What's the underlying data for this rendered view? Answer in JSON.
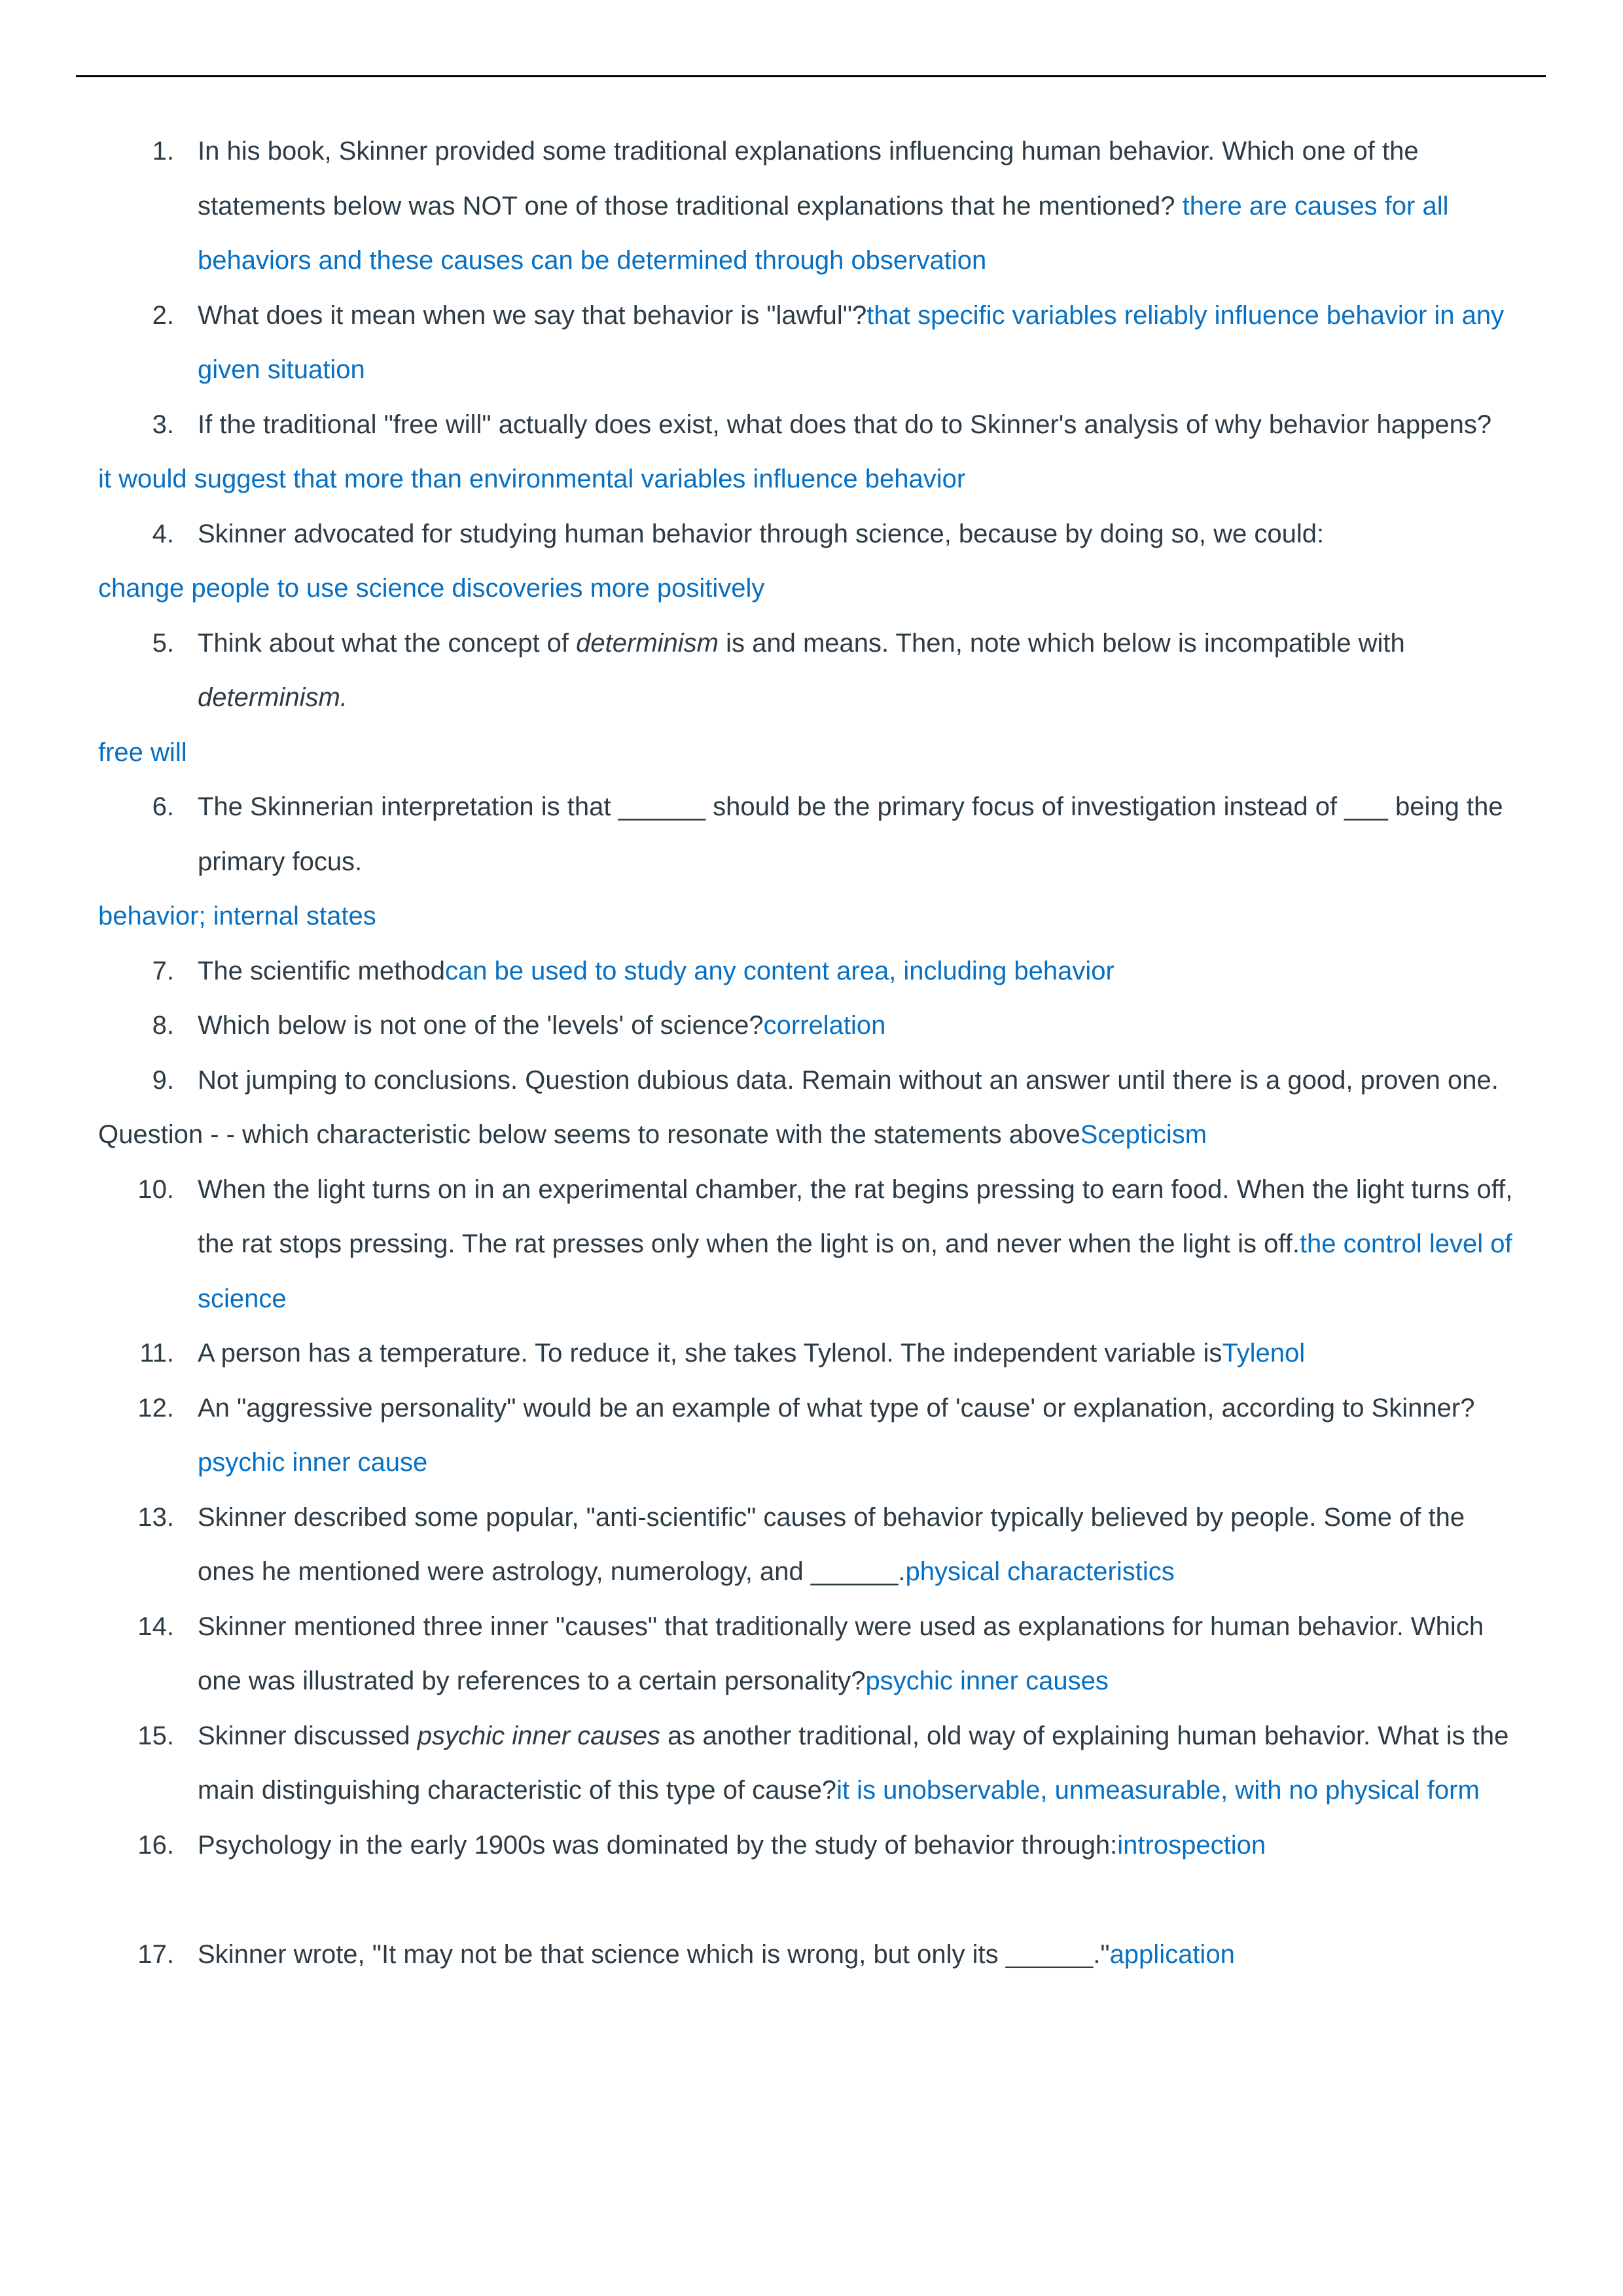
{
  "colors": {
    "question_text": "#2d3b45",
    "answer_text": "#0770c2",
    "rule": "#000000"
  },
  "questions": [
    {
      "n": "1.",
      "parts": [
        {
          "t": "In his book, Skinner provided some traditional explanations influencing human behavior. Which one of the statements below was NOT one of those traditional explanations that he mentioned? "
        },
        {
          "a": "there are causes for all behaviors and these causes can be determined through observation"
        }
      ]
    },
    {
      "n": "2.",
      "parts": [
        {
          "t": "What does it mean when we say that behavior is \"lawful\"?"
        },
        {
          "a": "that specific variables reliably influence behavior in any given situation"
        }
      ]
    },
    {
      "n": "3.",
      "parts": [
        {
          "t": "If the traditional \"free will\" actually does exist, what does that do to Skinner's analysis of why behavior happens?"
        }
      ],
      "after": "it would suggest that more than environmental variables influence behavior"
    },
    {
      "n": "4.",
      "parts": [
        {
          "t": "Skinner advocated for studying human behavior through science, because by doing so, we could:"
        }
      ],
      "after": "change people to use science discoveries more positively"
    },
    {
      "n": "5.",
      "parts": [
        {
          "t": "Think about what the concept of "
        },
        {
          "i": "determinism"
        },
        {
          "t": " is and means. Then, note which below is incompatible with "
        },
        {
          "i": "determinism."
        }
      ],
      "after": "free will"
    },
    {
      "n": "6.",
      "parts": [
        {
          "t": "The Skinnerian interpretation is that ______ should be the primary focus of investigation instead of ___ being the primary focus."
        }
      ],
      "after": "behavior; internal states"
    },
    {
      "n": "7.",
      "parts": [
        {
          "t": "The scientific method"
        },
        {
          "a": "can be used to study any content area, including behavior"
        }
      ]
    },
    {
      "n": "8.",
      "parts": [
        {
          "t": "Which below is not one of the 'levels' of science?"
        },
        {
          "a": "correlation"
        }
      ]
    },
    {
      "n": "9.",
      "parts": [
        {
          "t": "Not jumping to conclusions. Question dubious data. Remain without an answer until there is a good, proven one."
        }
      ],
      "after_q": "Question - - which characteristic below seems to resonate with the statements above",
      "after_a": "Scepticism"
    },
    {
      "n": "10.",
      "parts": [
        {
          "t": "When the light turns on in an experimental chamber, the rat begins pressing to earn food. When the light turns off, the rat stops pressing. The rat presses only when the light is on, and never when the light is off."
        },
        {
          "a": "the control level of science"
        }
      ]
    },
    {
      "n": "11.",
      "parts": [
        {
          "t": "A person has a temperature. To reduce it, she takes Tylenol. The independent variable is"
        },
        {
          "a": "Tylenol"
        }
      ]
    },
    {
      "n": "12.",
      "parts": [
        {
          "t": "An \"aggressive personality\" would be an example of what type of 'cause' or explanation, according to Skinner? "
        },
        {
          "a": "psychic inner cause"
        }
      ]
    },
    {
      "n": "13.",
      "parts": [
        {
          "t": "Skinner described some popular, \"anti-scientific\" causes of behavior typically believed by people. Some of the ones he mentioned were astrology, numerology, and ______."
        },
        {
          "a": "physical characteristics"
        }
      ]
    },
    {
      "n": "14.",
      "parts": [
        {
          "t": "Skinner mentioned three inner \"causes\" that traditionally were used as explanations for human behavior. Which one was illustrated by references to a certain personality?"
        },
        {
          "a": "psychic inner causes"
        }
      ]
    },
    {
      "n": "15.",
      "parts": [
        {
          "t": "Skinner discussed "
        },
        {
          "i": "psychic inner causes"
        },
        {
          "t": " as another traditional, old way of explaining human behavior. What is the main distinguishing characteristic of this type of cause?"
        },
        {
          "a": "it is unobservable, unmeasurable, with no physical form"
        }
      ]
    },
    {
      "n": "16.",
      "parts": [
        {
          "t": "Psychology in the early 1900s was dominated by the study of behavior through:"
        },
        {
          "a": "introspection"
        }
      ],
      "gap_after": true
    },
    {
      "n": "17.",
      "parts": [
        {
          "t": "Skinner wrote, \"It may not be that science which is wrong, but only its ______.\""
        },
        {
          "a": "application"
        }
      ]
    }
  ]
}
